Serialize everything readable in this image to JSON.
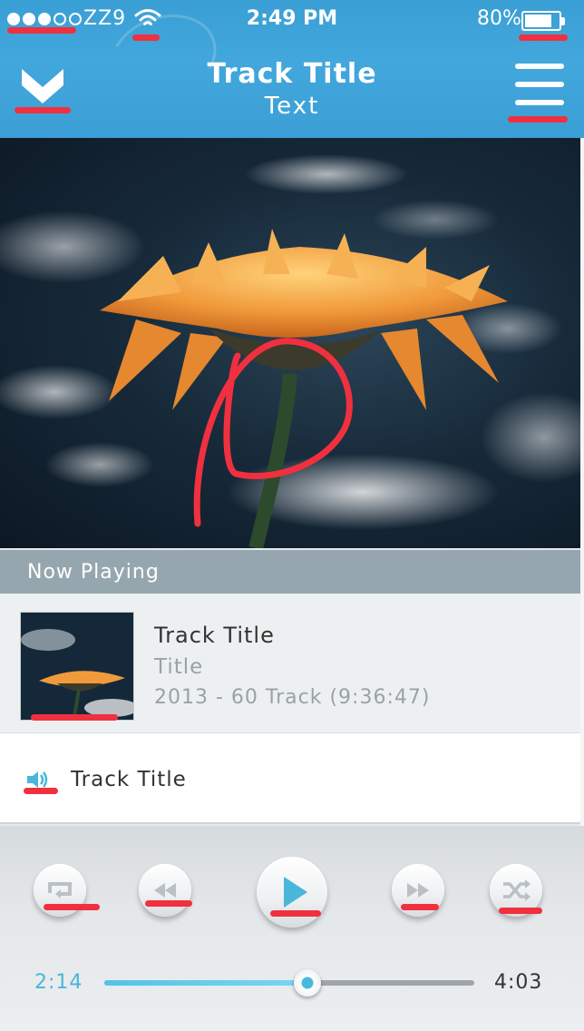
{
  "status_bar": {
    "signal_strength": "3 of 5",
    "carrier": "ZZ9",
    "time": "2:49 PM",
    "battery_percent": "80%",
    "battery_level": 0.8
  },
  "header": {
    "title": "Track Title",
    "subtitle": "Text",
    "back_icon": "chevron-down-icon",
    "menu_icon": "hamburger-icon"
  },
  "now_playing": {
    "label": "Now Playing",
    "album": {
      "title": "Track Title",
      "subtitle": "Title",
      "meta": "2013 - 60 Track (9:36:47)"
    },
    "current_track": {
      "icon": "speaker-icon",
      "title": "Track Title"
    }
  },
  "controls": {
    "repeat_icon": "repeat-icon",
    "rewind_icon": "rewind-icon",
    "play_icon": "play-icon",
    "forward_icon": "fast-forward-icon",
    "shuffle_icon": "shuffle-icon"
  },
  "progress": {
    "current": "2:14",
    "total": "4:03",
    "fraction": 0.55
  },
  "colors": {
    "header_blue": "#3ea3d8",
    "accent_cyan": "#4ab6d9",
    "annotation_red": "#f0303f",
    "section_gray": "#96a6ae"
  }
}
